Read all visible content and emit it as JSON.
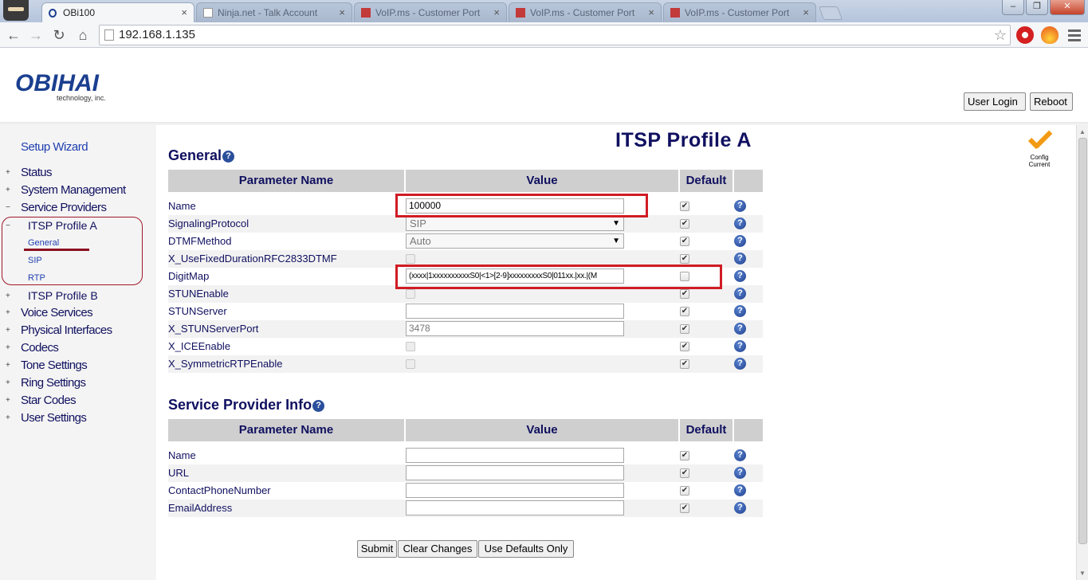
{
  "browser": {
    "tabs": [
      {
        "title": "OBi100",
        "active": true
      },
      {
        "title": "Ninja.net - Talk Account",
        "active": false
      },
      {
        "title": "VoIP.ms - Customer Port",
        "active": false
      },
      {
        "title": "VoIP.ms - Customer Port",
        "active": false
      },
      {
        "title": "VoIP.ms - Customer Port",
        "active": false
      }
    ],
    "tab_close": "×",
    "url": "192.168.1.135",
    "window_buttons": [
      "–",
      "❐",
      "✕"
    ]
  },
  "header": {
    "logo_text": "OBIHAI",
    "logo_sub": "technology, inc.",
    "user_login": "User Login",
    "reboot": "Reboot"
  },
  "nav": {
    "setup_wizard": "Setup Wizard",
    "items": [
      {
        "label": "Status",
        "sign": "+"
      },
      {
        "label": "System Management",
        "sign": "+"
      },
      {
        "label": "Service Providers",
        "sign": "−"
      },
      {
        "label": "ITSP Profile A",
        "sign": "−"
      },
      {
        "label": "General",
        "sign": ""
      },
      {
        "label": "SIP",
        "sign": ""
      },
      {
        "label": "RTP",
        "sign": ""
      },
      {
        "label": "ITSP Profile B",
        "sign": "+"
      },
      {
        "label": "Voice Services",
        "sign": "+"
      },
      {
        "label": "Physical Interfaces",
        "sign": "+"
      },
      {
        "label": "Codecs",
        "sign": "+"
      },
      {
        "label": "Tone Settings",
        "sign": "+"
      },
      {
        "label": "Ring Settings",
        "sign": "+"
      },
      {
        "label": "Star Codes",
        "sign": "+"
      },
      {
        "label": "User Settings",
        "sign": "+"
      }
    ]
  },
  "main": {
    "title": "ITSP Profile A",
    "config_status": [
      "Config",
      "Current"
    ],
    "help_glyph": "?",
    "general": {
      "heading": "General",
      "col_param": "Parameter Name",
      "col_value": "Value",
      "col_default": "Default",
      "rows": [
        {
          "name": "Name",
          "type": "text",
          "value": "100000",
          "default": true
        },
        {
          "name": "SignalingProtocol",
          "type": "select",
          "value": "SIP",
          "default": true
        },
        {
          "name": "DTMFMethod",
          "type": "select",
          "value": "Auto",
          "default": true
        },
        {
          "name": "X_UseFixedDurationRFC2833DTMF",
          "type": "check",
          "value": "",
          "default": true
        },
        {
          "name": "DigitMap",
          "type": "text",
          "value": "(xxxx|1xxxxxxxxxxS0|<1>[2-9]xxxxxxxxxS0|011xx.|xx.|(M",
          "default": false
        },
        {
          "name": "STUNEnable",
          "type": "check",
          "value": "",
          "default": true
        },
        {
          "name": "STUNServer",
          "type": "text",
          "value": "",
          "default": true
        },
        {
          "name": "X_STUNServerPort",
          "type": "text",
          "value": "3478",
          "default": true
        },
        {
          "name": "X_ICEEnable",
          "type": "check",
          "value": "",
          "default": true
        },
        {
          "name": "X_SymmetricRTPEnable",
          "type": "check",
          "value": "",
          "default": true
        }
      ]
    },
    "provider_info": {
      "heading": "Service Provider Info",
      "col_param": "Parameter Name",
      "col_value": "Value",
      "col_default": "Default",
      "rows": [
        {
          "name": "Name",
          "value": "",
          "default": true
        },
        {
          "name": "URL",
          "value": "",
          "default": true
        },
        {
          "name": "ContactPhoneNumber",
          "value": "",
          "default": true
        },
        {
          "name": "EmailAddress",
          "value": "",
          "default": true
        }
      ]
    },
    "buttons": {
      "submit": "Submit",
      "clear": "Clear Changes",
      "defaults": "Use Defaults Only"
    }
  },
  "colors": {
    "navy_text": "#101060",
    "link_blue": "#1f3fb0",
    "annotation_red": "#d01c24",
    "header_gray": "#cfcfcf"
  }
}
